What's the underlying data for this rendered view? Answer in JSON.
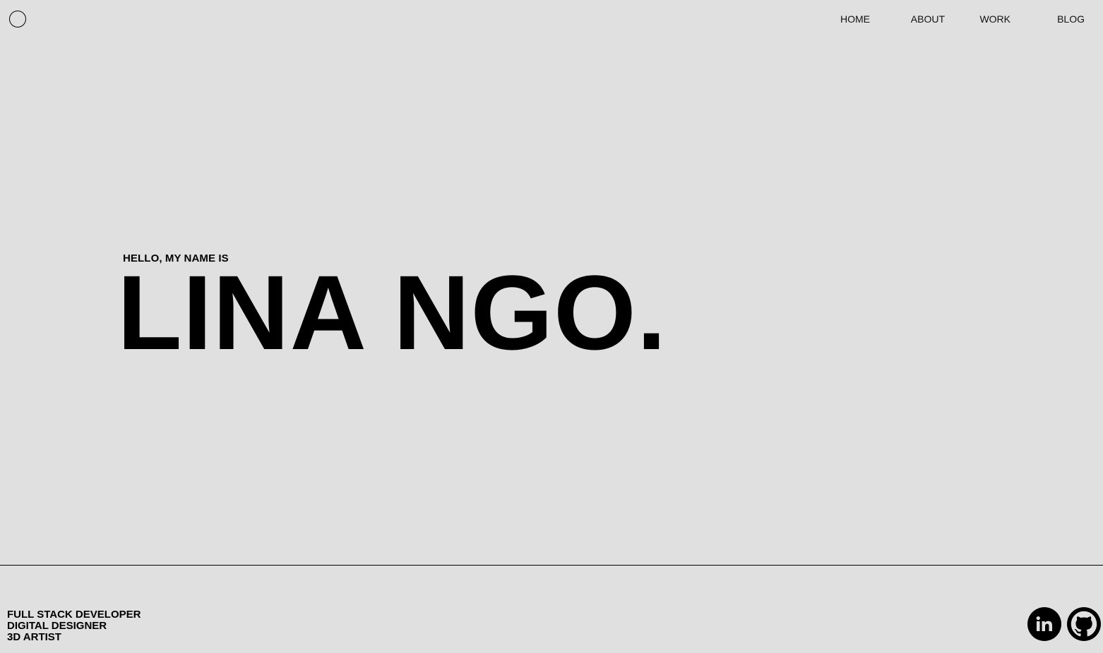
{
  "nav": {
    "items": [
      "HOME",
      "ABOUT",
      "WORK",
      "BLOG"
    ]
  },
  "hero": {
    "kicker": "HELLO, MY NAME IS",
    "name": "LINA NGO."
  },
  "footer": {
    "roles": [
      "FULL STACK DEVELOPER",
      "DIGITAL DESIGNER",
      "3D ARTIST"
    ],
    "social": [
      {
        "icon": "linkedin-icon"
      },
      {
        "icon": "github-icon"
      }
    ]
  },
  "colors": {
    "background": "#e0e0e0",
    "text": "#000000"
  }
}
